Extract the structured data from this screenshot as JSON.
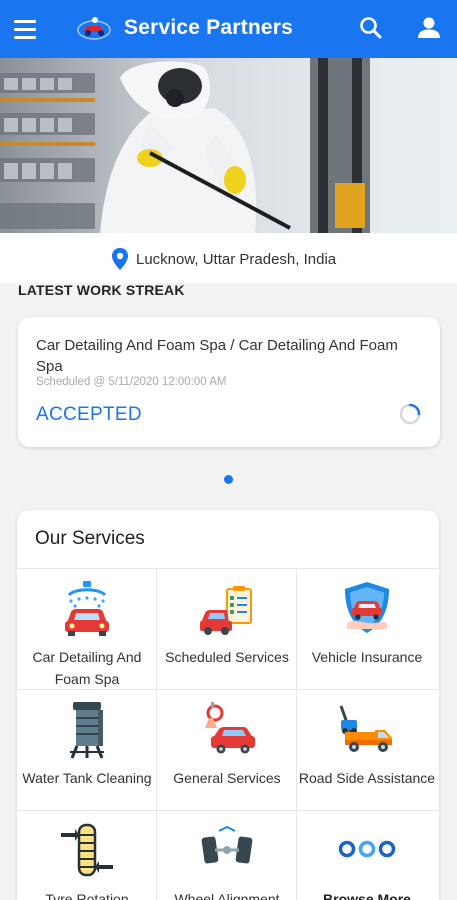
{
  "app": {
    "title": "Service Partners",
    "brand_color": "#1976f0"
  },
  "header": {
    "menu_icon": "hamburger-menu-icon",
    "search_icon": "search-icon",
    "profile_icon": "user-profile-icon"
  },
  "banner": {
    "image": "worker-in-protective-suit-spraying-disinfectant",
    "slide_count": 2,
    "active_slide": 1
  },
  "location": {
    "icon": "location-pin-icon",
    "text": "Lucknow, Uttar Pradesh, India"
  },
  "work_streak": {
    "heading": "LATEST WORK STREAK",
    "card": {
      "title": "Car Detailing And Foam Spa / Car Detailing And Foam Spa",
      "scheduled": "Scheduled @ 5/11/2020 12:00:00 AM",
      "status": "ACCEPTED"
    }
  },
  "services": {
    "heading": "Our Services",
    "items": [
      {
        "label": "Car Detailing And Foam Spa",
        "icon": "car-wash-icon"
      },
      {
        "label": "Scheduled Services",
        "icon": "scheduled-services-icon"
      },
      {
        "label": "Vehicle Insurance",
        "icon": "vehicle-insurance-icon"
      },
      {
        "label": "Water Tank Cleaning",
        "icon": "water-tank-icon"
      },
      {
        "label": "General Services",
        "icon": "general-services-icon"
      },
      {
        "label": "Road Side Assistance",
        "icon": "tow-truck-icon"
      },
      {
        "label": "Tyre Rotation",
        "icon": "tyre-rotation-icon"
      },
      {
        "label": "Wheel Alignment",
        "icon": "wheel-alignment-icon"
      },
      {
        "label": "Browse More",
        "icon": "more-dots-icon"
      }
    ]
  }
}
